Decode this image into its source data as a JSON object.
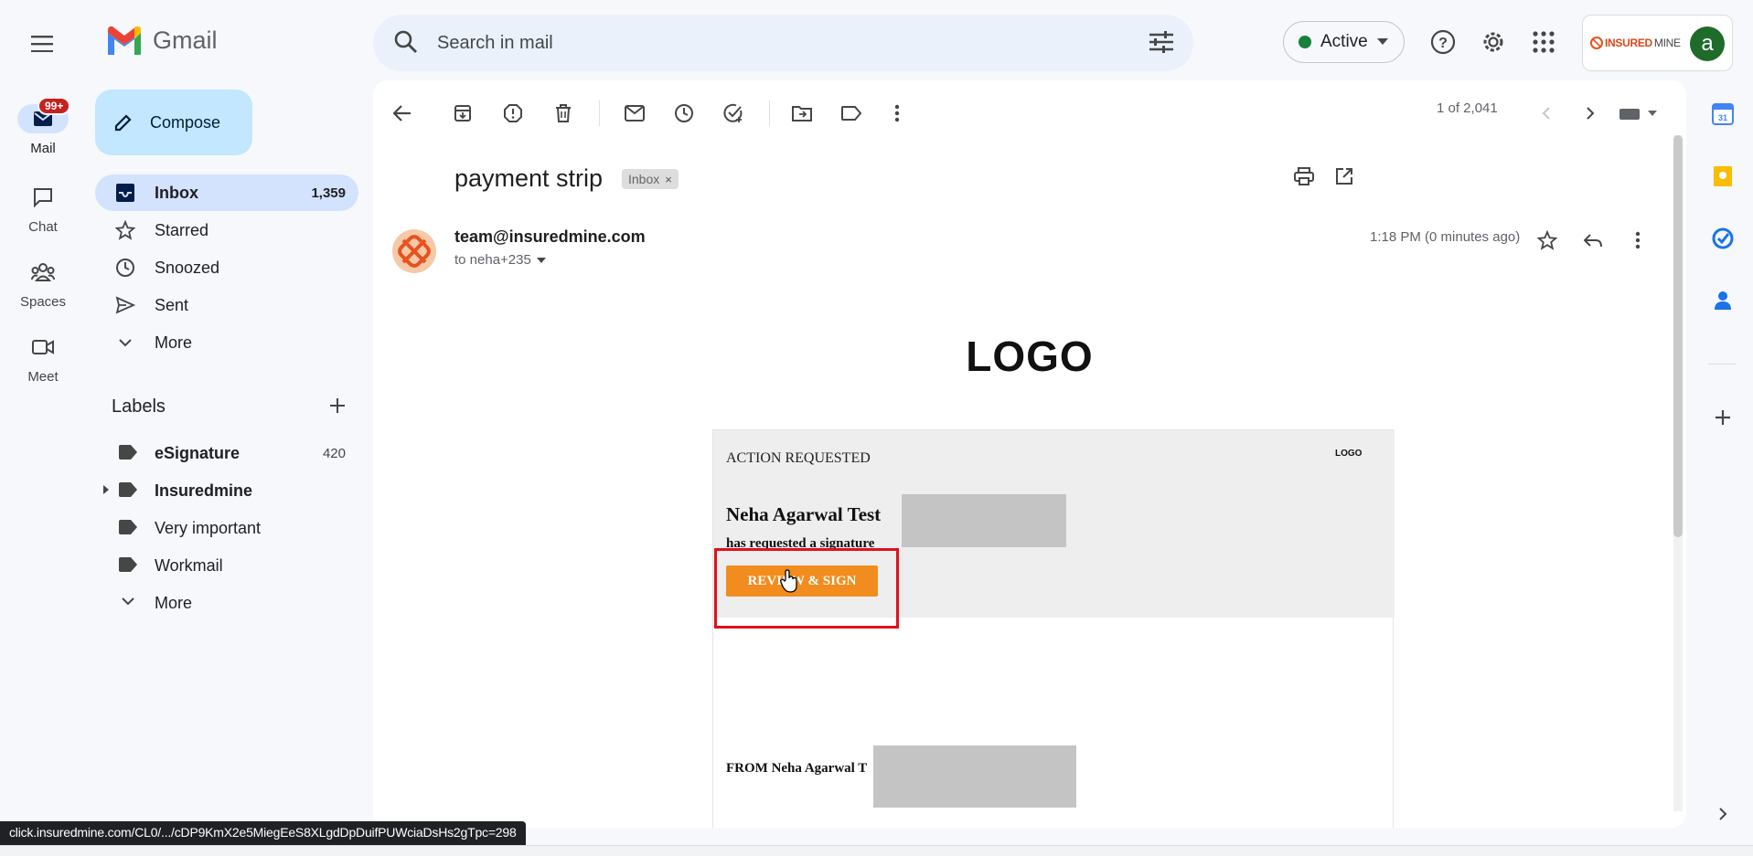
{
  "app": {
    "name": "Gmail"
  },
  "search": {
    "placeholder": "Search in mail"
  },
  "status": {
    "label": "Active",
    "color": "#188038"
  },
  "account": {
    "logo_brand": "INSURED",
    "logo_brand_rest": "MINE",
    "initial": "a"
  },
  "rail": [
    {
      "label": "Mail",
      "badge": "99+",
      "active": true
    },
    {
      "label": "Chat"
    },
    {
      "label": "Spaces"
    },
    {
      "label": "Meet"
    }
  ],
  "nav": {
    "compose": "Compose",
    "items": [
      {
        "label": "Inbox",
        "count": "1,359",
        "active": true
      },
      {
        "label": "Starred"
      },
      {
        "label": "Snoozed"
      },
      {
        "label": "Sent"
      },
      {
        "label": "More"
      }
    ]
  },
  "labels": {
    "header": "Labels",
    "items": [
      {
        "name": "eSignature",
        "count": "420",
        "bold": true
      },
      {
        "name": "Insuredmine",
        "bold": true
      },
      {
        "name": "Very important"
      },
      {
        "name": "Workmail"
      },
      {
        "name": "More"
      }
    ]
  },
  "toolbar": {
    "pager": "1 of 2,041"
  },
  "message": {
    "subject": "payment strip",
    "chip": "Inbox",
    "sender": "team@insuredmine.com",
    "to": "to neha+235",
    "time": "1:18 PM (0 minutes ago)"
  },
  "email_body": {
    "logo": "LOGO",
    "action": "ACTION REQUESTED",
    "mini_logo": "LOGO",
    "requester": "Neha Agarwal Test",
    "request_text": "has requested a signature",
    "button": "REVIEW & SIGN",
    "from": "FROM Neha Agarwal T"
  },
  "statusbar": {
    "url": "click.insuredmine.com/CL0/.../cDP9KmX2e5MiegEeS8XLgdDpDuifPUWciaDsHs2gTpc=298"
  },
  "colors": {
    "accent": "#c2e7ff",
    "review_button": "#f28c1e",
    "highlight": "#e0101a"
  }
}
